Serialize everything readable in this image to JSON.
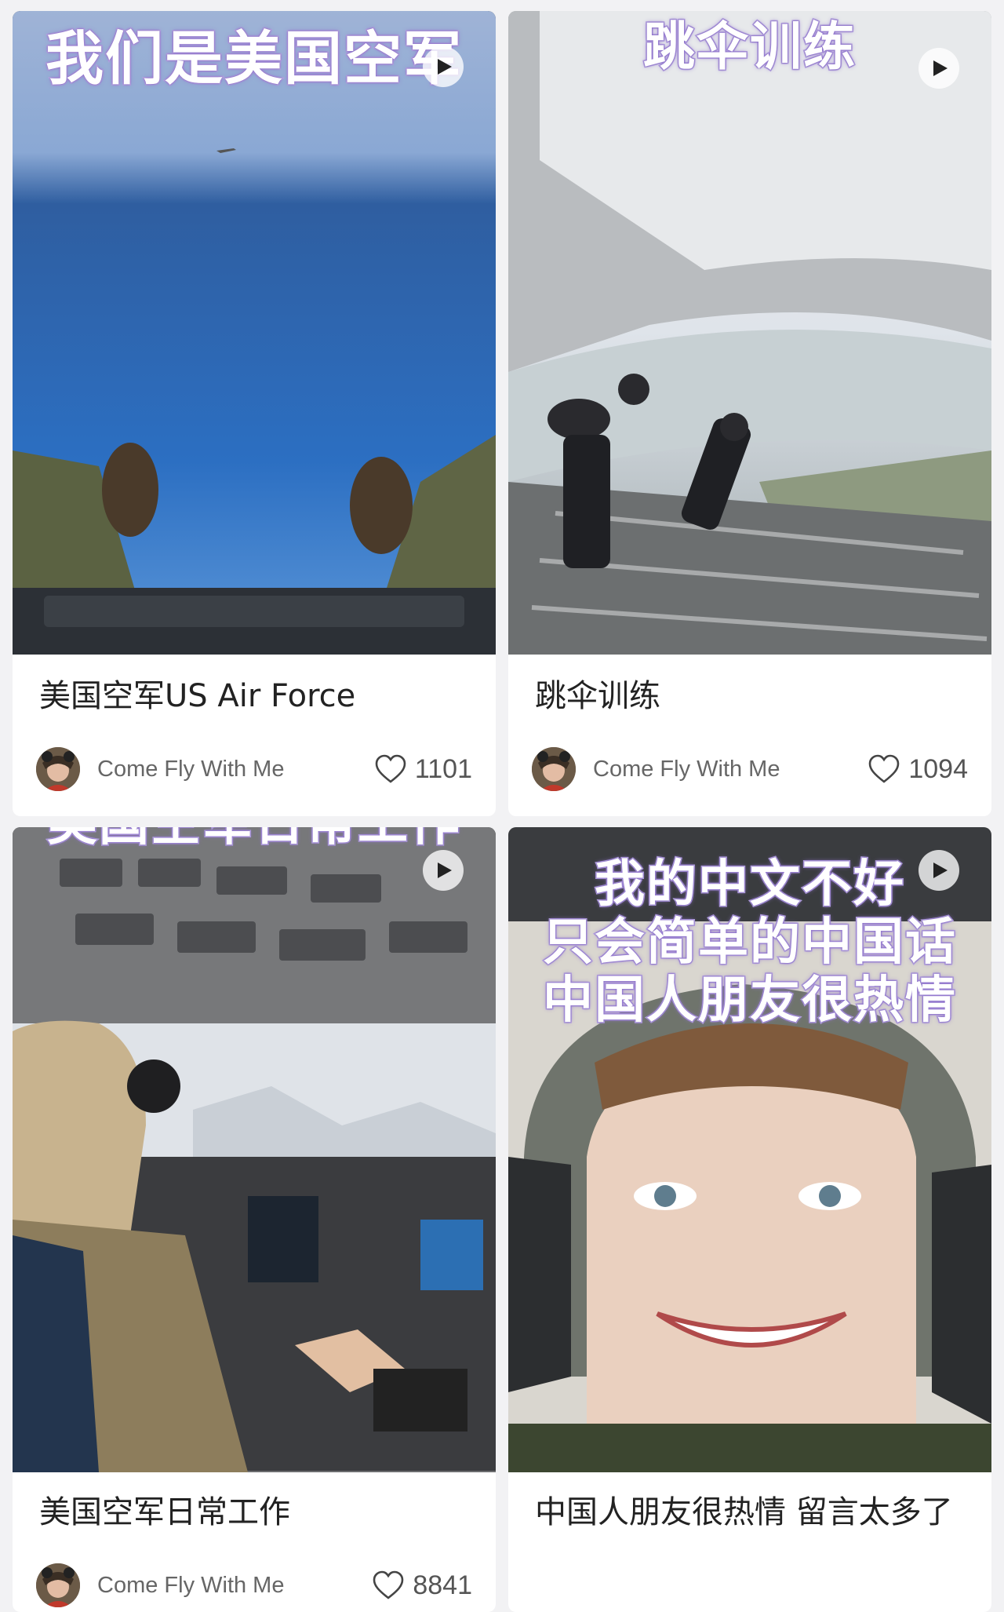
{
  "cards": [
    {
      "overlay_lines": [
        "我们是美国空军"
      ],
      "title": "美国空军US Air Force",
      "author": "Come Fly With Me",
      "likes": "1101",
      "icon": "play-icon"
    },
    {
      "overlay_lines": [
        "跳伞训练"
      ],
      "title": "跳伞训练",
      "author": "Come Fly With Me",
      "likes": "1094",
      "icon": "play-icon"
    },
    {
      "overlay_lines": [
        "美国空军日常工作"
      ],
      "title": "美国空军日常工作",
      "author": "Come Fly With Me",
      "likes": "8841",
      "icon": "play-icon"
    },
    {
      "overlay_lines": [
        "我的中文不好",
        "只会简单的中国话",
        "中国人朋友很热情"
      ],
      "title": "中国人朋友很热情 留言太多了",
      "author": "",
      "likes": "",
      "icon": "play-icon"
    }
  ],
  "colors": {
    "page_bg": "#f2f2f4",
    "card_bg": "#ffffff",
    "title_text": "#222222",
    "meta_text": "#666666",
    "overlay_text": "#ffffff",
    "overlay_outline": "#b6a4e0"
  }
}
